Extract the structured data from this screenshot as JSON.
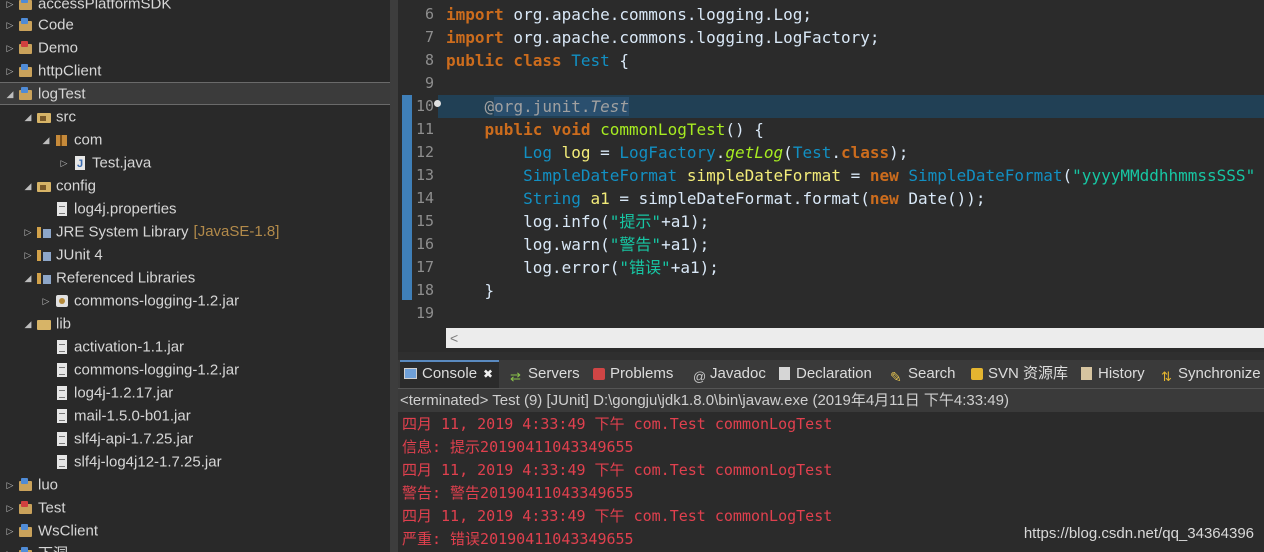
{
  "explorer": {
    "rows": [
      {
        "label": "accessPlatformSDK",
        "icon": "project"
      },
      {
        "label": "Code",
        "icon": "project"
      },
      {
        "label": "Demo",
        "icon": "project-error"
      },
      {
        "label": "httpClient",
        "icon": "project"
      },
      {
        "label": "logTest",
        "icon": "project"
      },
      {
        "label": "src",
        "icon": "source-folder"
      },
      {
        "label": "com",
        "icon": "package"
      },
      {
        "label": "Test.java",
        "icon": "java-file"
      },
      {
        "label": "config",
        "icon": "source-folder"
      },
      {
        "label": "log4j.properties",
        "icon": "file"
      },
      {
        "label": "JRE System Library",
        "icon": "library",
        "decoration": "[JavaSE-1.8]"
      },
      {
        "label": "JUnit 4",
        "icon": "library"
      },
      {
        "label": "Referenced Libraries",
        "icon": "library"
      },
      {
        "label": "commons-logging-1.2.jar",
        "icon": "jar"
      },
      {
        "label": "lib",
        "icon": "folder"
      },
      {
        "label": "activation-1.1.jar",
        "icon": "file"
      },
      {
        "label": "commons-logging-1.2.jar",
        "icon": "file"
      },
      {
        "label": "log4j-1.2.17.jar",
        "icon": "file"
      },
      {
        "label": "mail-1.5.0-b01.jar",
        "icon": "file"
      },
      {
        "label": "slf4j-api-1.7.25.jar",
        "icon": "file"
      },
      {
        "label": "slf4j-log4j12-1.7.25.jar",
        "icon": "file"
      },
      {
        "label": "luo",
        "icon": "project"
      },
      {
        "label": "Test",
        "icon": "project-error"
      },
      {
        "label": "WsClient",
        "icon": "project"
      },
      {
        "label": "下洞",
        "icon": "project"
      }
    ]
  },
  "editor": {
    "line_numbers": [
      "6",
      "7",
      "8",
      "9",
      "10",
      "11",
      "12",
      "13",
      "14",
      "15",
      "16",
      "17",
      "18",
      "19"
    ],
    "code": {
      "l6_kw": "import",
      "l6_rest": " org.apache.commons.logging.Log;",
      "l7_kw": "import",
      "l7_rest": " org.apache.commons.logging.LogFactory;",
      "l8_kw1": "public",
      "l8_kw2": " class",
      "l8_type": " Test",
      "l8_rest": " {",
      "l10_at": "@",
      "l10_pkg": "org.junit.",
      "l10_ann": "Test",
      "l11_kw1": "public",
      "l11_kw2": " void",
      "l11_meth": " commonLogTest",
      "l11_rest": "() {",
      "l12_type": "Log",
      "l12_var": " log",
      "l12_eq": " = ",
      "l12_type2": "LogFactory",
      "l12_dot": ".",
      "l12_smeth": "getLog",
      "l12_p1": "(",
      "l12_type3": "Test",
      "l12_dot2": ".",
      "l12_kw": "class",
      "l12_end": ");",
      "l13_type": "SimpleDateFormat",
      "l13_var": " simpleDateFormat",
      "l13_eq": " = ",
      "l13_kw": "new",
      "l13_type2": " SimpleDateFormat",
      "l13_p": "(",
      "l13_str": "\"yyyyMMddhhmmssSSS\"",
      "l14_type": "String",
      "l14_var": " a1",
      "l14_eq": " = ",
      "l14_obj": "simpleDateFormat",
      "l14_dot": ".",
      "l14_meth": "format",
      "l14_p": "(",
      "l14_kw": "new",
      "l14_rest": " Date());",
      "l15_obj": "log",
      "l15_dot": ".",
      "l15_meth": "info",
      "l15_p": "(",
      "l15_str": "\"提示\"",
      "l15_plus": "+",
      "l15_var": "a1",
      "l15_end": ");",
      "l16_obj": "log",
      "l16_dot": ".",
      "l16_meth": "warn",
      "l16_p": "(",
      "l16_str": "\"警告\"",
      "l16_plus": "+",
      "l16_var": "a1",
      "l16_end": ");",
      "l17_obj": "log",
      "l17_dot": ".",
      "l17_meth": "error",
      "l17_p": "(",
      "l17_str": "\"错误\"",
      "l17_plus": "+",
      "l17_var": "a1",
      "l17_end": ");",
      "l18": "}"
    },
    "scroll_arrow": "<"
  },
  "console": {
    "tabs": [
      {
        "label": "Console",
        "icon": "console"
      },
      {
        "label": "Servers",
        "icon": "servers"
      },
      {
        "label": "Problems",
        "icon": "problems"
      },
      {
        "label": "Javadoc",
        "icon": "javadoc"
      },
      {
        "label": "Declaration",
        "icon": "declaration"
      },
      {
        "label": "Search",
        "icon": "search"
      },
      {
        "label": "SVN 资源库",
        "icon": "svn"
      },
      {
        "label": "History",
        "icon": "history"
      },
      {
        "label": "Synchronize",
        "icon": "sync"
      }
    ],
    "close_glyph": "✖",
    "status": "<terminated> Test (9) [JUnit] D:\\gongju\\jdk1.8.0\\bin\\javaw.exe (2019年4月11日 下午4:33:49)",
    "output": [
      "四月 11, 2019 4:33:49 下午 com.Test commonLogTest",
      "信息: 提示20190411043349655",
      "四月 11, 2019 4:33:49 下午 com.Test commonLogTest",
      "警告: 警告20190411043349655",
      "四月 11, 2019 4:33:49 下午 com.Test commonLogTest",
      "严重: 错误20190411043349655"
    ],
    "text_color": "#e0404e"
  },
  "watermark": "https://blog.csdn.net/qq_34364396"
}
